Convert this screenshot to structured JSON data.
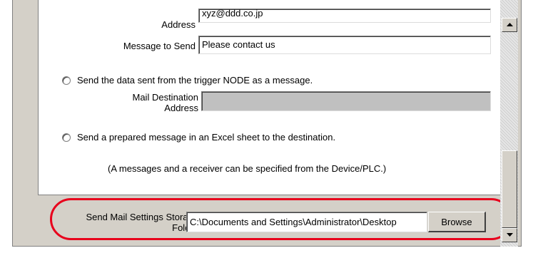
{
  "form": {
    "address_label": "Address",
    "address_value": "xyz@ddd.co.jp",
    "message_label": "Message to Send",
    "message_value": "Please contact us",
    "option_trigger": "Send the data sent from the trigger NODE as a message.",
    "mail_dest_label_line1": "Mail Destination",
    "mail_dest_label_line2": "Address",
    "option_excel": "Send a prepared message in an Excel sheet to the destination.",
    "note": "(A messages and a receiver can be specified from the Device/PLC.)"
  },
  "storage": {
    "label_line1": "Send Mail Settings Storage",
    "label_line2": "Folder",
    "path_value": "C:\\Documents and Settings\\Administrator\\Desktop",
    "browse_label": "Browse"
  },
  "colors": {
    "highlight": "#e8001c",
    "panel": "#d4d0c8"
  }
}
